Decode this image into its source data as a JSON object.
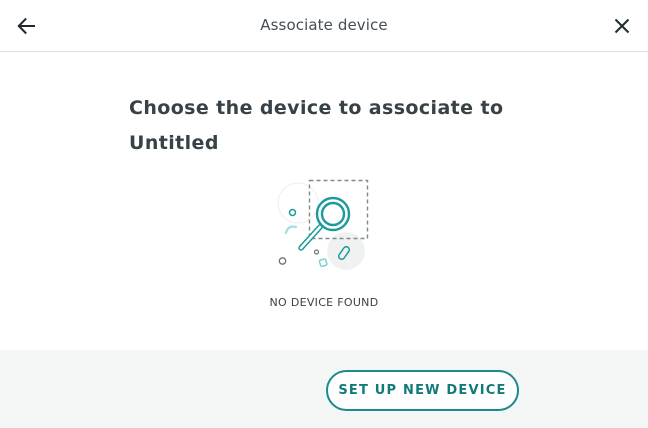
{
  "header": {
    "title": "Associate device",
    "back_icon": "arrow-left-icon",
    "close_icon": "close-icon"
  },
  "main": {
    "heading": "Choose the device to associate to Untitled",
    "illustration_icon": "magnifier-search-icon",
    "empty_state_label": "NO DEVICE FOUND"
  },
  "footer": {
    "setup_button_label": "SET UP NEW DEVICE"
  },
  "colors": {
    "accent": "#1c8a8a",
    "text": "#374146",
    "footer_background": "#f4f6f6",
    "divider": "#dae3e3"
  }
}
